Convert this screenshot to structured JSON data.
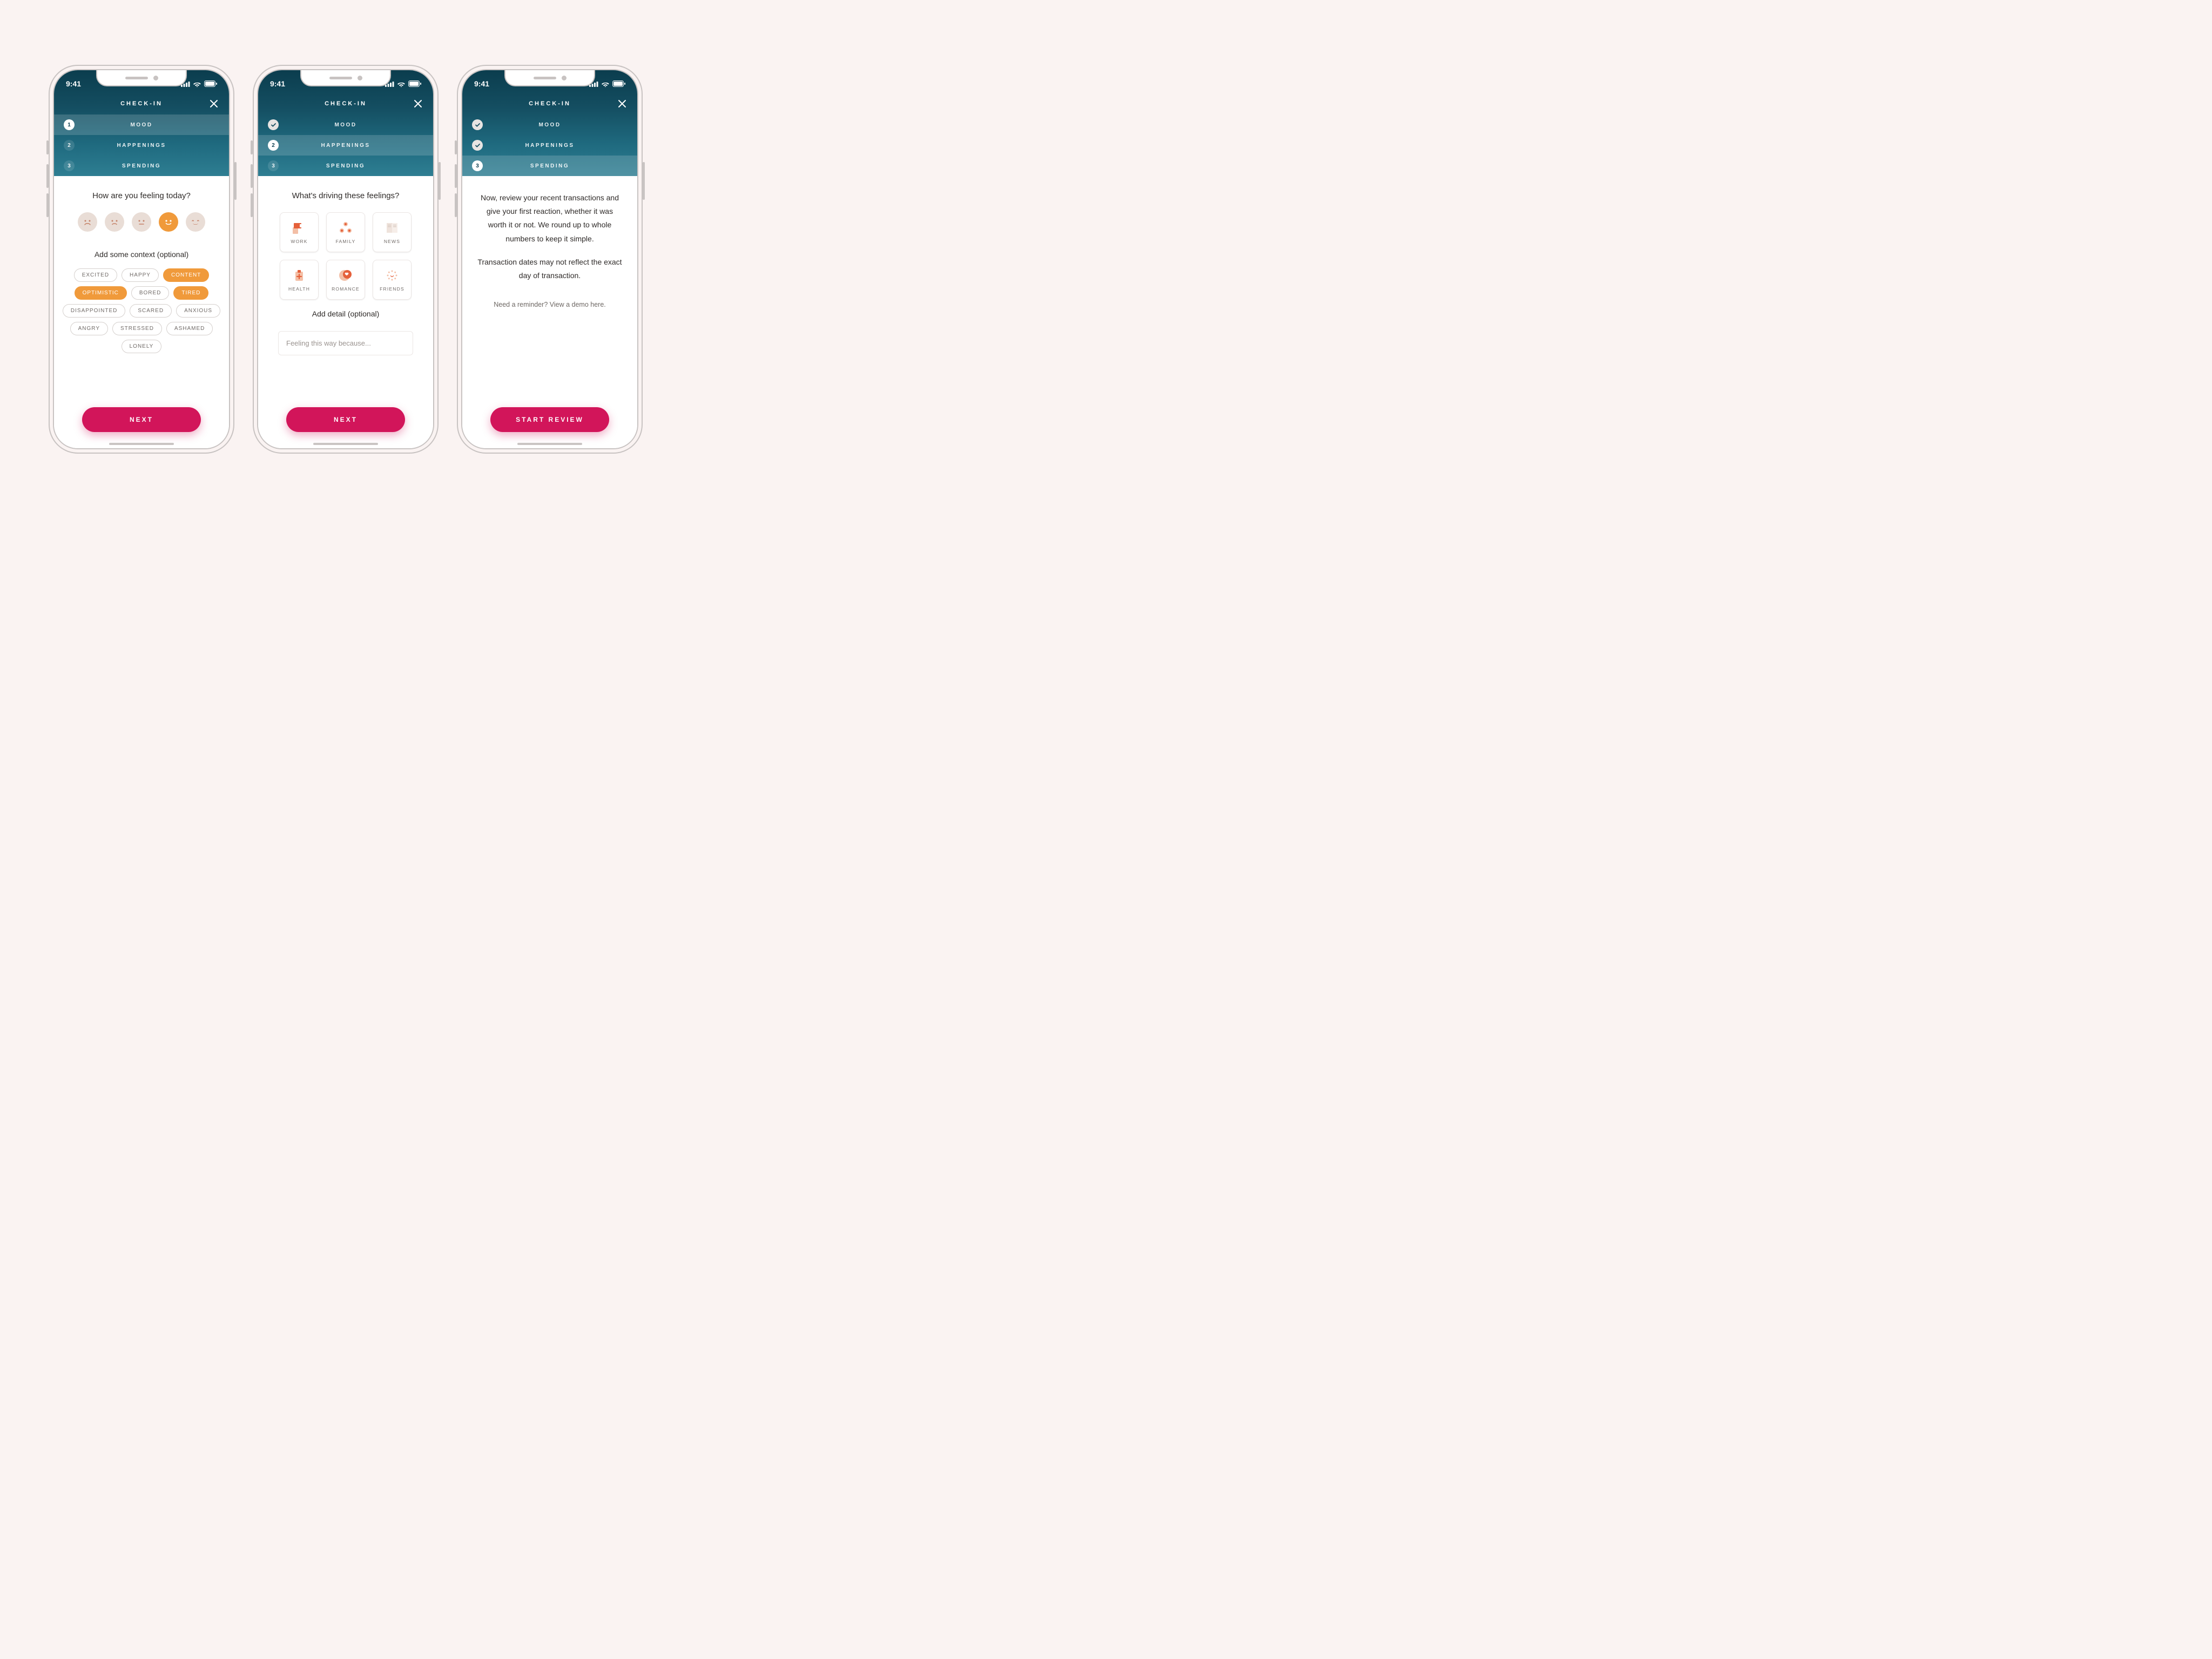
{
  "statusbar": {
    "time": "9:41"
  },
  "titlebar": {
    "title": "CHECK-IN"
  },
  "steps": {
    "items": [
      {
        "num": "1",
        "label": "MOOD"
      },
      {
        "num": "2",
        "label": "HAPPENINGS"
      },
      {
        "num": "3",
        "label": "SPENDING"
      }
    ]
  },
  "screen1": {
    "prompt": "How are you feeling today?",
    "sub": "Add some context (optional)",
    "chips": [
      "EXCITED",
      "HAPPY",
      "CONTENT",
      "OPTIMISTIC",
      "BORED",
      "TIRED",
      "DISAPPOINTED",
      "SCARED",
      "ANXIOUS",
      "ANGRY",
      "STRESSED",
      "ASHAMED",
      "LONELY"
    ],
    "chips_on": [
      "CONTENT",
      "OPTIMISTIC",
      "TIRED"
    ],
    "face_selected_index": 3,
    "cta": "NEXT"
  },
  "screen2": {
    "prompt": "What's driving these feelings?",
    "categories": [
      "WORK",
      "FAMILY",
      "NEWS",
      "HEALTH",
      "ROMANCE",
      "FRIENDS"
    ],
    "sub": "Add detail (optional)",
    "placeholder": "Feeling this way because...",
    "cta": "NEXT"
  },
  "screen3": {
    "p1": "Now, review your recent transactions and give your first reaction, whether it was worth it or not. We round up to whole numbers to keep it simple.",
    "p2": "Transaction dates may not reflect the exact day of transaction.",
    "hint": "Need a reminder? View a demo here.",
    "cta": "START REVIEW"
  },
  "colors": {
    "accent_pink": "#D2155A",
    "accent_orange": "#F09A3B",
    "teal_header": "#1F6A7F"
  }
}
